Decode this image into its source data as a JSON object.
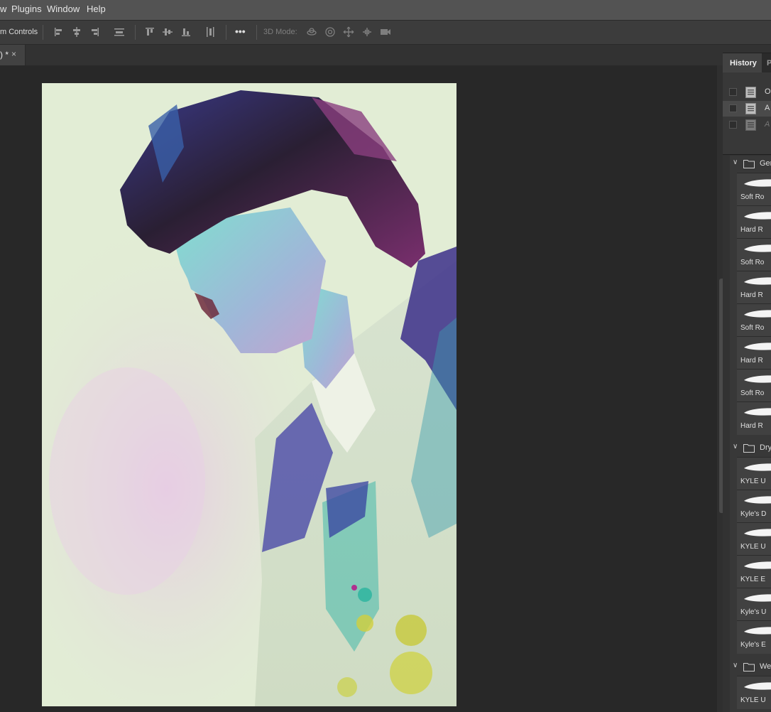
{
  "menu": [
    "w",
    "Plugins",
    "Window",
    "Help"
  ],
  "options_bar": {
    "transform_controls_label": "m Controls",
    "more_label": "•••",
    "mode_label": "3D Mode:"
  },
  "document_tab": {
    "name": ") *",
    "close": "×"
  },
  "panel": {
    "tabs": [
      "History",
      "P"
    ],
    "history_items": [
      {
        "label": "O",
        "selected": false,
        "dimmed": false
      },
      {
        "label": "A",
        "selected": true,
        "dimmed": false
      },
      {
        "label": "A",
        "selected": false,
        "dimmed": true
      }
    ],
    "folders": [
      {
        "label": "Ger",
        "brushes": [
          "Soft Ro",
          "Hard R",
          "Soft Ro",
          "Hard R",
          "Soft Ro",
          "Hard R",
          "Soft Ro",
          "Hard R"
        ]
      },
      {
        "label": "Dry",
        "brushes": [
          "KYLE U",
          "Kyle's D",
          "KYLE U",
          "KYLE E",
          "Kyle's U",
          "Kyle's E"
        ]
      },
      {
        "label": "We",
        "brushes": [
          "KYLE U"
        ]
      }
    ]
  },
  "colors": {
    "canvas_bg": "#282828",
    "panel_bg": "#323232",
    "accent_blue": "#3c4dba",
    "hair_purple": "#6b2a6a"
  }
}
